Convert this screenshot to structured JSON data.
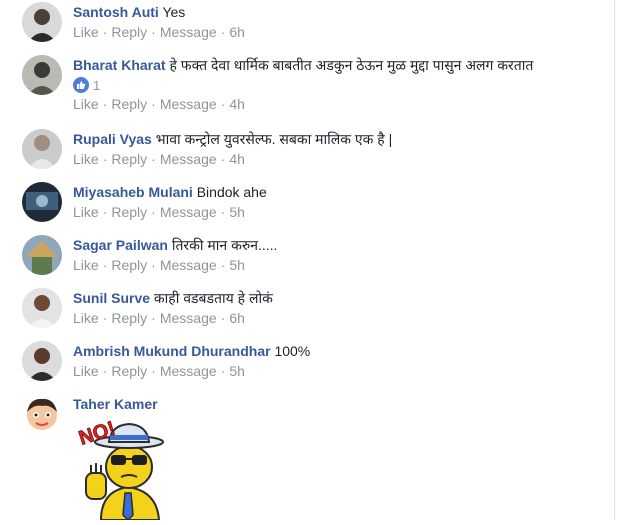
{
  "colors": {
    "author": "#385898",
    "muted": "#90949c",
    "text": "#1d2129",
    "like_badge": "#4f7ddb"
  },
  "actions": {
    "like": "Like",
    "reply": "Reply",
    "message": "Message",
    "separator": "·"
  },
  "comments": [
    {
      "author": "Santosh Auti",
      "text": "Yes",
      "time": "6h",
      "avatar": "photo-avatar"
    },
    {
      "author": "Bharat Kharat",
      "text": "हे फक्त देवा धार्मिक बाबतीत अडकुन ठेऊन मुळ मुद्दा पासुन अलग करतात",
      "reaction_count": "1",
      "time": "4h",
      "avatar": "photo-avatar"
    },
    {
      "author": "Rupali Vyas",
      "text": "भावा कन्ट्रोल युवरसेल्फ. सबका मालिक एक है |",
      "time": "4h",
      "avatar": "photo-avatar"
    },
    {
      "author": "Miyasaheb Mulani",
      "text": "Bindok ahe",
      "time": "5h",
      "avatar": "photo-avatar"
    },
    {
      "author": "Sagar Pailwan",
      "text": "तिरकी मान करुन.....",
      "time": "5h",
      "avatar": "photo-avatar"
    },
    {
      "author": "Sunil Surve",
      "text": "काही वडबडताय हे लोकं",
      "time": "6h",
      "avatar": "photo-avatar"
    },
    {
      "author": "Ambrish Mukund Dhurandhar",
      "text": "100%",
      "time": "5h",
      "avatar": "photo-avatar"
    },
    {
      "author": "Taher Kamer",
      "text": "",
      "avatar": "cartoon-avatar",
      "sticker": "no-sticker",
      "sticker_text": "NO!"
    }
  ]
}
